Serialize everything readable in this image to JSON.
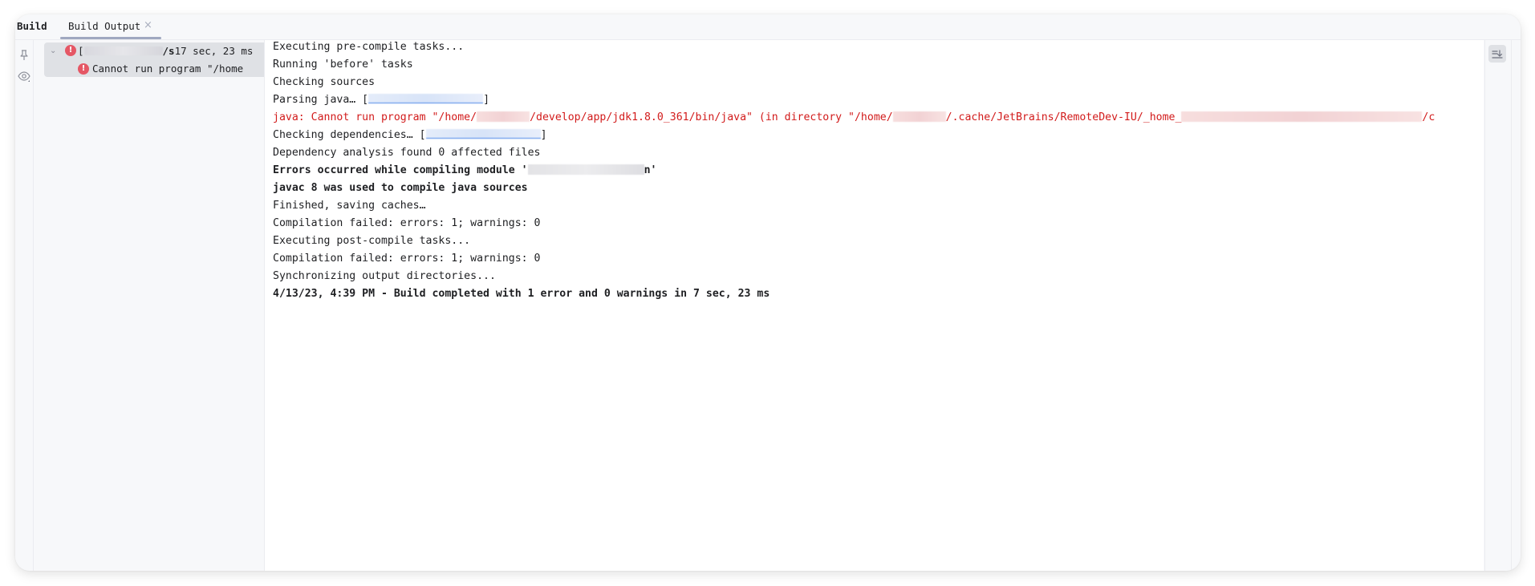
{
  "window": {
    "tool_window_title": "Build",
    "tabs": [
      {
        "label": "Build Output",
        "active": true,
        "close_icon": "close-icon"
      }
    ]
  },
  "left_toolbar": {
    "icons": [
      "pin-icon",
      "eye-icon"
    ]
  },
  "tree": {
    "root": {
      "status_icon": "error-icon",
      "label_prefix": "[",
      "label_suffix": "/s",
      "duration": "17 sec, 23 ms",
      "expanded": true
    },
    "children": [
      {
        "status_icon": "error-icon",
        "label": "Cannot run program \"/home"
      }
    ]
  },
  "console": {
    "lines": [
      {
        "text": "Executing pre-compile tasks...",
        "style": "normal"
      },
      {
        "text": "Running 'before' tasks",
        "style": "normal"
      },
      {
        "text": "Checking sources",
        "style": "normal"
      },
      {
        "text": "Parsing java… [",
        "suffix": "]",
        "style": "normal",
        "redacted_link": true
      },
      {
        "text": "java: Cannot run program \"/home/",
        "mid": "/develop/app/jdk1.8.0_361/bin/java\" (in directory \"/home/",
        "tail": "/.cache/JetBrains/RemoteDev-IU/_home_",
        "end": "/c",
        "style": "error"
      },
      {
        "text": "Checking dependencies… [",
        "suffix": "]",
        "style": "normal",
        "redacted_link": true
      },
      {
        "text": "Dependency analysis found 0 affected files",
        "style": "normal"
      },
      {
        "text": "Errors occurred while compiling module '",
        "suffix": "n'",
        "style": "bold"
      },
      {
        "text": "javac 8 was used to compile java sources",
        "style": "bold"
      },
      {
        "text": "Finished, saving caches…",
        "style": "normal"
      },
      {
        "text": "Compilation failed: errors: 1; warnings: 0",
        "style": "normal"
      },
      {
        "text": "Executing post-compile tasks...",
        "style": "normal"
      },
      {
        "text": "Compilation failed: errors: 1; warnings: 0",
        "style": "normal"
      },
      {
        "text": "Synchronizing output directories...",
        "style": "normal"
      },
      {
        "text": "4/13/23, 4:39 PM - Build completed with 1 error and 0 warnings in 7 sec, 23 ms",
        "style": "bold"
      }
    ]
  },
  "right_toolbar": {
    "scroll_to_end_icon": "scroll-to-end-icon"
  },
  "colors": {
    "error_text": "#d21b1b",
    "error_icon": "#e55765",
    "selection": "#dfe1e5",
    "link": "#4a86e8"
  }
}
